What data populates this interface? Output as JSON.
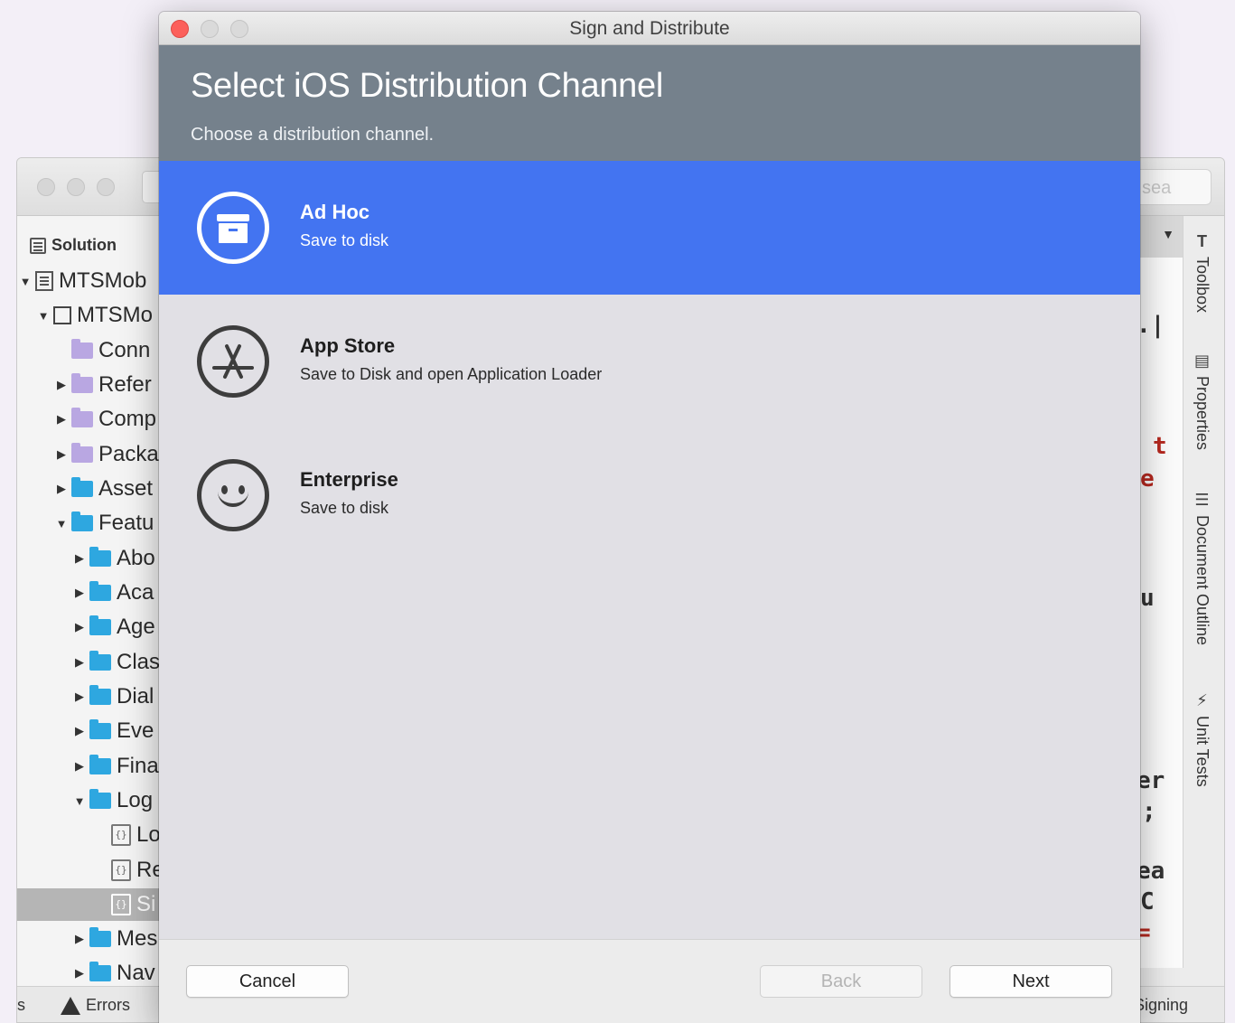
{
  "background_window": {
    "search_placeholder": "sea",
    "solution_pad": {
      "title": "Solution",
      "tree": [
        {
          "label": "MTSMob",
          "icon": "solution-icon",
          "expanded": true
        },
        {
          "label": "MTSMo",
          "icon": "project-icon",
          "expanded": true
        },
        {
          "label": "Conn",
          "icon": "connected-services-icon"
        },
        {
          "label": "Refer",
          "icon": "references-folder-icon"
        },
        {
          "label": "Comp",
          "icon": "components-folder-icon"
        },
        {
          "label": "Packa",
          "icon": "packages-folder-icon"
        },
        {
          "label": "Asset",
          "icon": "folder-icon"
        },
        {
          "label": "Featu",
          "icon": "folder-icon",
          "expanded": true
        },
        {
          "label": "Abo",
          "icon": "folder-icon"
        },
        {
          "label": "Aca",
          "icon": "folder-icon"
        },
        {
          "label": "Age",
          "icon": "folder-icon"
        },
        {
          "label": "Clas",
          "icon": "folder-icon"
        },
        {
          "label": "Dial",
          "icon": "folder-icon"
        },
        {
          "label": "Eve",
          "icon": "folder-icon"
        },
        {
          "label": "Fina",
          "icon": "folder-icon"
        },
        {
          "label": "Log",
          "icon": "folder-icon",
          "expanded": true
        },
        {
          "label": "Lo",
          "icon": "code-file-icon"
        },
        {
          "label": "Re",
          "icon": "code-file-icon"
        },
        {
          "label": "Si",
          "icon": "code-file-icon",
          "selected": true
        },
        {
          "label": "Mes",
          "icon": "folder-icon"
        },
        {
          "label": "Nav",
          "icon": "folder-icon"
        }
      ]
    },
    "code_fragments": [
      ".|",
      "t",
      "e",
      "u",
      "er",
      ";",
      "ea",
      "C",
      "="
    ],
    "side_tabs": [
      "Toolbox",
      "Properties",
      "Document Outline",
      "Unit Tests"
    ],
    "bottom_bar": {
      "left_fragment": "s",
      "errors_label": "Errors",
      "right_fragment": "Signing"
    }
  },
  "dialog": {
    "window_title": "Sign and Distribute",
    "heading": "Select iOS Distribution Channel",
    "subheading": "Choose a distribution channel.",
    "accent_color": "#4374f1",
    "channels": [
      {
        "name": "Ad Hoc",
        "description": "Save to disk",
        "icon": "archive-box-icon",
        "selected": true
      },
      {
        "name": "App Store",
        "description": "Save to Disk and open Application Loader",
        "icon": "app-store-icon",
        "selected": false
      },
      {
        "name": "Enterprise",
        "description": "Save to disk",
        "icon": "smiley-icon",
        "selected": false
      }
    ],
    "buttons": {
      "cancel": "Cancel",
      "back": "Back",
      "next": "Next"
    }
  }
}
